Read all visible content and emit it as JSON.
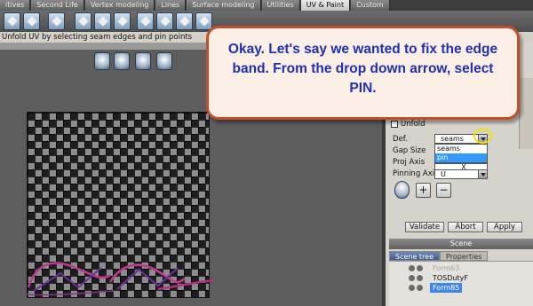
{
  "tabs": [
    {
      "label": "itives",
      "active": false
    },
    {
      "label": "Second Life",
      "active": false
    },
    {
      "label": "Vertex modeling",
      "active": false
    },
    {
      "label": "Lines",
      "active": false
    },
    {
      "label": "Surface modeling",
      "active": false
    },
    {
      "label": "Utilities",
      "active": false
    },
    {
      "label": "UV & Paint",
      "active": true
    },
    {
      "label": "Custom",
      "active": false
    }
  ],
  "status_text": "Unfold UV by selecting seam edges and pin points",
  "callout_text": "Okay. Let's say we wanted to fix the edge band. From the drop down arrow, select PIN.",
  "unfold": {
    "label": "Unfold"
  },
  "properties": {
    "def_label": "Def.",
    "def_value": "seams",
    "gap_label": "Gap Size",
    "proj_label": "Proj Axis",
    "proj_value": "X",
    "pin_label": "Pinning Axi",
    "pin_value": "U"
  },
  "dropdown_options": [
    "seams",
    "pin"
  ],
  "icon_buttons": {
    "plus": "+",
    "minus": "−"
  },
  "actions": {
    "validate": "Validate",
    "abort": "Abort",
    "apply": "Apply"
  },
  "scene": {
    "title": "Scene",
    "tabs": [
      "Scene tree",
      "Properties"
    ],
    "items": [
      "Form63",
      "TOSDutyF",
      "Form85"
    ]
  },
  "colors": {
    "callout_text": "#1f2fb8",
    "callout_border": "#c14f2c",
    "selected": "#3e86e8",
    "highlight_ring": "#e8e800"
  }
}
